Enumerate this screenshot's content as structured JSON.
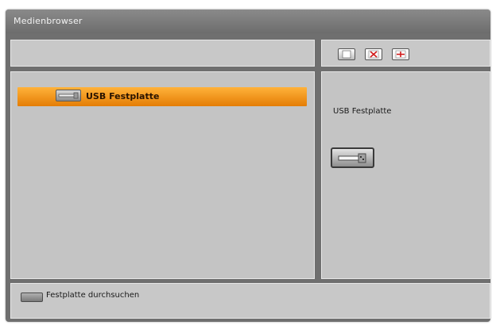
{
  "window": {
    "title": "Medienbrowser"
  },
  "list": {
    "items": [
      {
        "label": "USB Festplatte",
        "icon": "usb-drive-icon",
        "selected": true
      }
    ]
  },
  "toolbar": {
    "buttons": [
      {
        "icon": "blank-tile-icon"
      },
      {
        "icon": "red-cross-tile-icon"
      },
      {
        "icon": "red-plus-tile-icon"
      }
    ]
  },
  "detail": {
    "label": "USB Festplatte",
    "icon": "usb-drive-icon"
  },
  "hint": {
    "key_icon": "key-icon",
    "text": "Festplatte durchsuchen"
  },
  "colors": {
    "highlight": "#f39a1f",
    "panel": "#c4c4c4",
    "frame": "#6f6f6f",
    "accent_red": "#d11a1a"
  }
}
